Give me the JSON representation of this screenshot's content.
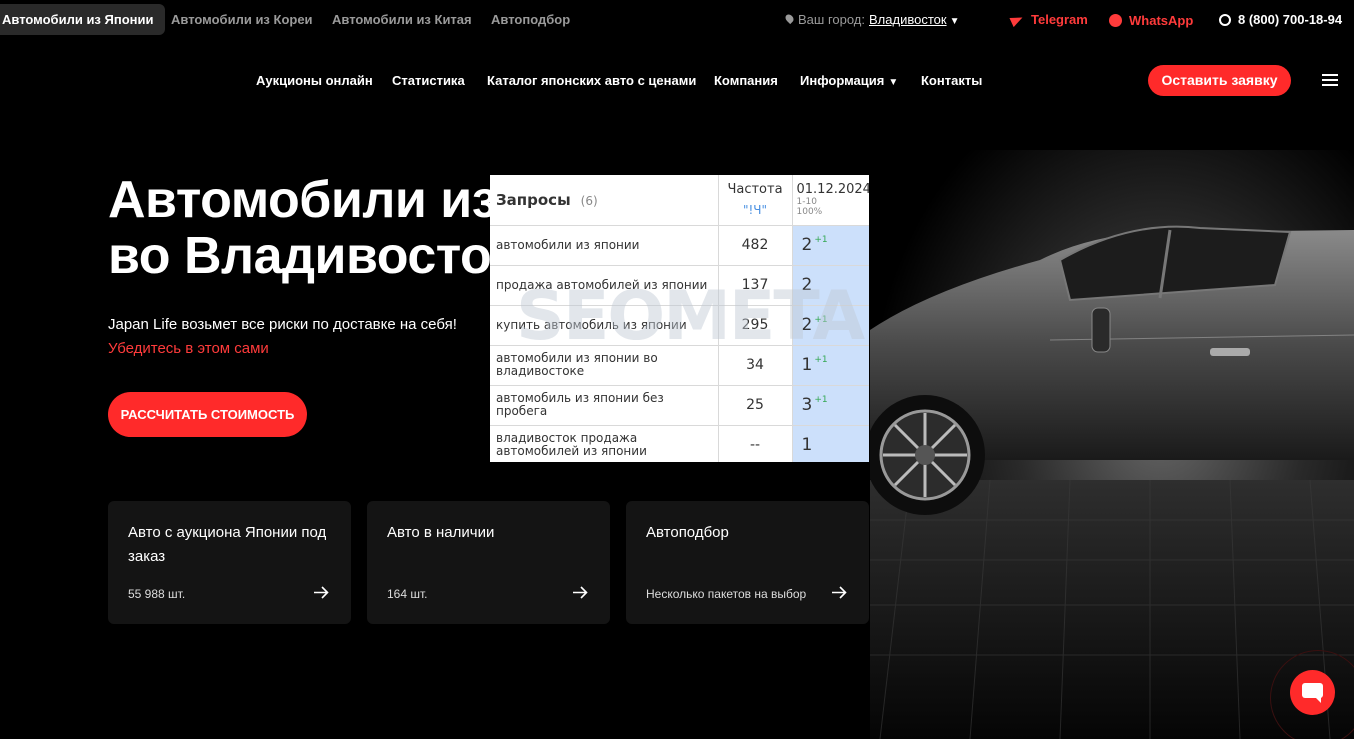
{
  "topnav": {
    "items": [
      "Автомобили из Японии",
      "Автомобили из Кореи",
      "Автомобили из Китая",
      "Автоподбор"
    ],
    "city_label": "Ваш город:",
    "city_value": "Владивосток",
    "telegram": "Telegram",
    "whatsapp": "WhatsApp",
    "phone": "8 (800) 700-18-94"
  },
  "mainnav": {
    "items": [
      "Аукционы онлайн",
      "Статистика",
      "Каталог японских авто с ценами",
      "Компания",
      "Информация",
      "Контакты"
    ],
    "cta": "Оставить заявку"
  },
  "hero": {
    "title": "Автомобили из Японии\nво Владивостоке",
    "subtitle": "Japan Life возьмет все риски по доставке на себя!",
    "subtitle_red": "Убедитесь в этом сами",
    "cta": "РАССЧИТАТЬ СТОИМОСТЬ"
  },
  "cards": [
    {
      "title": "Авто с аукциона Японии под заказ",
      "sub": "55 988 шт."
    },
    {
      "title": "Авто в наличии",
      "sub": "164 шт."
    },
    {
      "title": "Автоподбор",
      "sub": "Несколько пакетов на выбор"
    }
  ],
  "seo_table": {
    "header": {
      "queries": "Запросы",
      "count": "(6)",
      "freq": "Частота",
      "freq_sub": "\"!Ч\"",
      "date": "01.12.2024",
      "date_range": "1-10",
      "date_pct": "100%"
    },
    "rows": [
      {
        "query": "автомобили из японии",
        "freq": "482",
        "pos": "2",
        "delta": "+1"
      },
      {
        "query": "продажа автомобилей из японии",
        "freq": "137",
        "pos": "2",
        "delta": ""
      },
      {
        "query": "купить автомобиль из японии",
        "freq": "295",
        "pos": "2",
        "delta": "+1"
      },
      {
        "query": "автомобили из японии во владивостоке",
        "freq": "34",
        "pos": "1",
        "delta": "+1"
      },
      {
        "query": "автомобиль из японии без пробега",
        "freq": "25",
        "pos": "3",
        "delta": "+1"
      },
      {
        "query": "владивосток продажа автомобилей из японии",
        "freq": "--",
        "pos": "1",
        "delta": ""
      }
    ],
    "watermark": "SEOMETA"
  },
  "colors": {
    "accent": "#ff2a2a",
    "background": "#000000",
    "card": "#141414",
    "position_cell": "#cce0fb"
  },
  "icons": [
    "location-pin-icon",
    "chevron-down-icon",
    "telegram-icon",
    "whatsapp-icon",
    "phone-icon",
    "burger-menu-icon",
    "arrow-right-icon",
    "chat-icon"
  ]
}
